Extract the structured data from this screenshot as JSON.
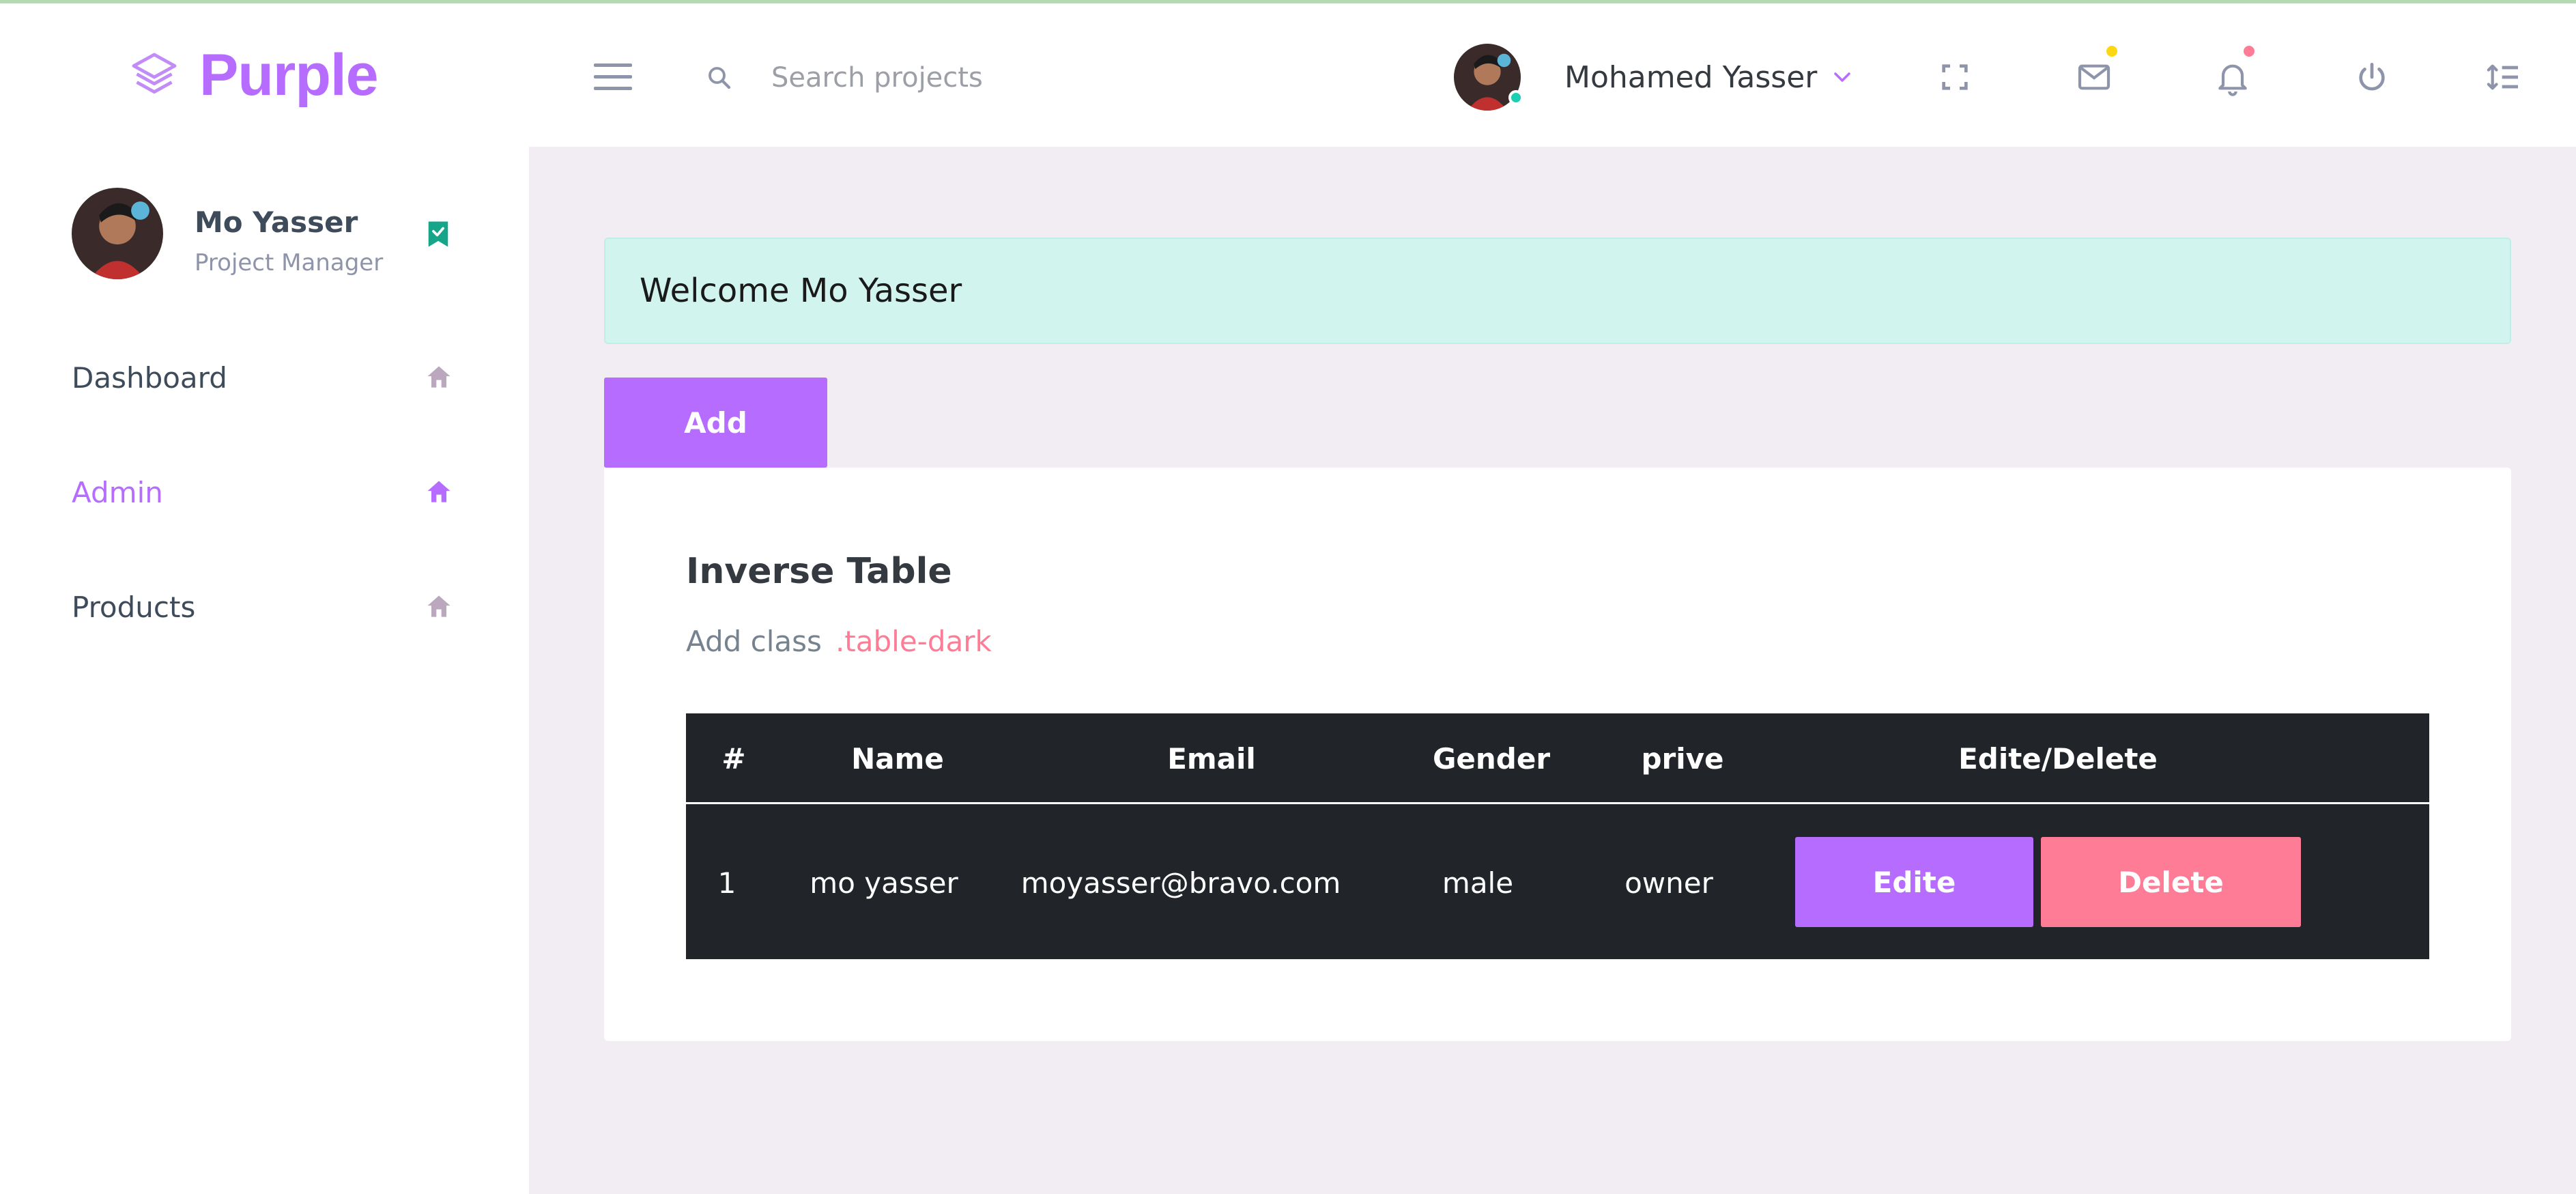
{
  "brand": {
    "name": "Purple",
    "icon": "layers-icon",
    "color": "#b66dff"
  },
  "navbar": {
    "search_placeholder": "Search projects",
    "user_name": "Mohamed Yasser",
    "icons": [
      "menu-icon",
      "search-icon",
      "fullscreen-icon",
      "mail-icon",
      "bell-icon",
      "power-icon",
      "format-line-spacing-icon"
    ],
    "mail_dot_color": "#fed713",
    "bell_dot_color": "#fe7c96"
  },
  "sidebar": {
    "profile": {
      "name": "Mo Yasser",
      "role": "Project Manager"
    },
    "items": [
      {
        "label": "Dashboard",
        "active": false
      },
      {
        "label": "Admin",
        "active": true
      },
      {
        "label": "Products",
        "active": false
      }
    ]
  },
  "main": {
    "welcome": "Welcome Mo Yasser",
    "add_label": "Add",
    "card": {
      "title": "Inverse Table",
      "desc": "Add class",
      "code": ".table-dark"
    },
    "table": {
      "headers": [
        "#",
        "Name",
        "Email",
        "Gender",
        "prive",
        "Edite/Delete"
      ],
      "rows": [
        {
          "id": "1",
          "name": "mo yasser",
          "email": "moyasser@bravo.com",
          "gender": "male",
          "prive": "owner",
          "edit_label": "Edite",
          "delete_label": "Delete"
        }
      ]
    }
  },
  "colors": {
    "accent": "#b66dff",
    "danger": "#fe7c96",
    "success": "#1bcfb4",
    "table_dark": "#212529"
  }
}
